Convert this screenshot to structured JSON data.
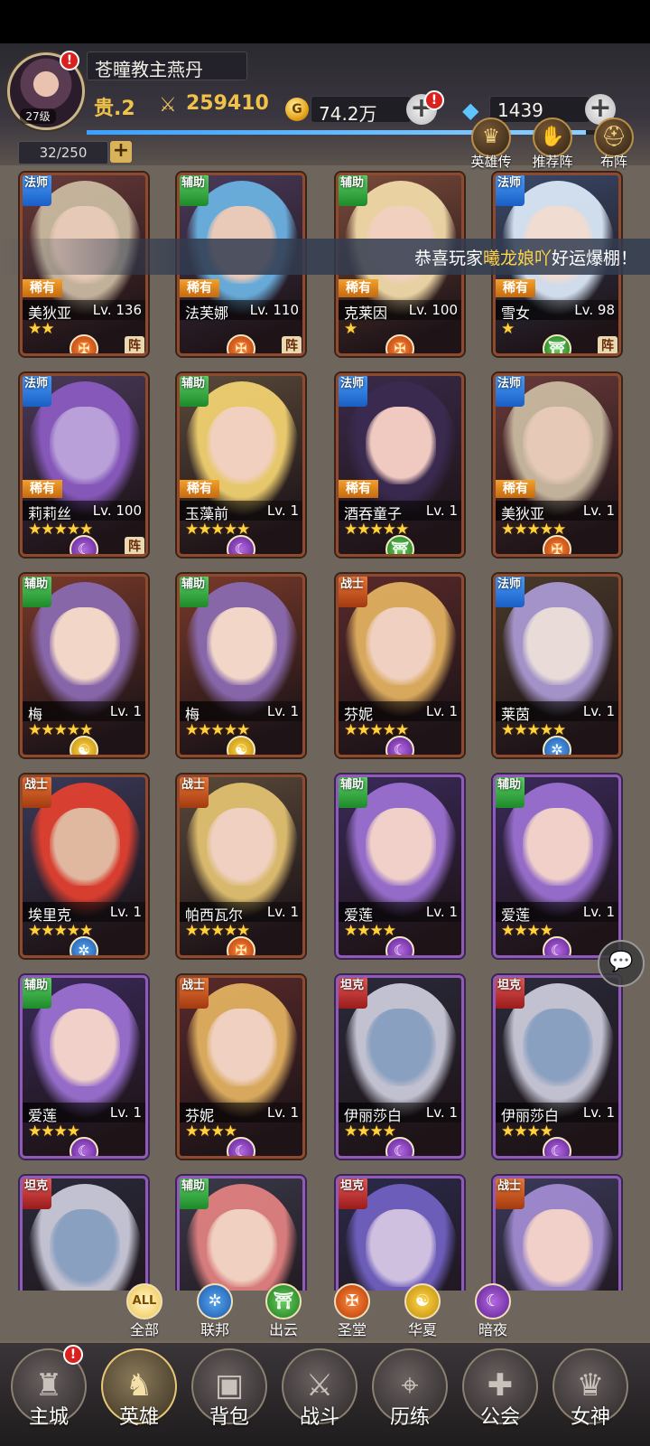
{
  "player": {
    "name": "苍瞳教主燕丹",
    "level": "27级",
    "vip": "贵.2",
    "power": "259410",
    "xp_fraction": 0.97
  },
  "resources": {
    "gold": "74.2万",
    "gems": "1439"
  },
  "roster_count": "32/250",
  "top_buttons": [
    {
      "label": "英雄传",
      "icon": "crown-icon"
    },
    {
      "label": "推荐阵",
      "icon": "thumbs-up-icon"
    },
    {
      "label": "布阵",
      "icon": "helmet-icon"
    }
  ],
  "announcement": {
    "prefix": "恭喜玩家",
    "player": "曦龙娘吖",
    "suffix": "好运爆棚！"
  },
  "heroes": [
    {
      "class": "法师",
      "cls": "mage",
      "rarity": "稀有",
      "name": "美狄亚",
      "level": "Lv. 136",
      "stars": "★★",
      "faction": "holy",
      "team": "阵",
      "frame": "bronze",
      "palette": [
        "#6a3a3a",
        "#c9b9a0",
        "#e7c9b8"
      ]
    },
    {
      "class": "辅助",
      "cls": "support",
      "rarity": "稀有",
      "name": "法芙娜",
      "level": "Lv. 110",
      "stars": "",
      "faction": "holy",
      "team": "阵",
      "frame": "bronze",
      "palette": [
        "#4a3a5a",
        "#6ab0e0",
        "#e9c9b8"
      ]
    },
    {
      "class": "辅助",
      "cls": "support",
      "rarity": "稀有",
      "name": "克莱因",
      "level": "Lv. 100",
      "stars": "★",
      "faction": "holy",
      "team": "",
      "frame": "bronze",
      "palette": [
        "#7a4a3a",
        "#f0d9a8",
        "#f2d0c0"
      ]
    },
    {
      "class": "法师",
      "cls": "mage",
      "rarity": "稀有",
      "name": "雪女",
      "level": "Lv. 98",
      "stars": "★",
      "faction": "cloud",
      "team": "阵",
      "frame": "bronze",
      "palette": [
        "#3a4a6a",
        "#d9e6f5",
        "#f0dcd0"
      ]
    },
    {
      "class": "法师",
      "cls": "mage",
      "rarity": "稀有",
      "name": "莉莉丝",
      "level": "Lv. 100",
      "stars": "★★★★★",
      "faction": "dark",
      "team": "阵",
      "frame": "bronze",
      "palette": [
        "#4a3a5a",
        "#8a5ac0",
        "#b9a0d9"
      ]
    },
    {
      "class": "辅助",
      "cls": "support",
      "rarity": "稀有",
      "name": "玉藻前",
      "level": "Lv. 1",
      "stars": "★★★★★",
      "faction": "dark",
      "team": "",
      "frame": "bronze",
      "palette": [
        "#5a4a3a",
        "#f0d070",
        "#f2d0c0"
      ]
    },
    {
      "class": "法师",
      "cls": "mage",
      "rarity": "稀有",
      "name": "酒吞童子",
      "level": "Lv. 1",
      "stars": "★★★★★",
      "faction": "cloud",
      "team": "",
      "frame": "bronze",
      "palette": [
        "#3a2a4a",
        "#3a2a50",
        "#f0c9c0"
      ]
    },
    {
      "class": "法师",
      "cls": "mage",
      "rarity": "稀有",
      "name": "美狄亚",
      "level": "Lv. 1",
      "stars": "★★★★★",
      "faction": "holy",
      "team": "",
      "frame": "bronze",
      "palette": [
        "#6a3a3a",
        "#c9b9a0",
        "#e7c9b8"
      ]
    },
    {
      "class": "辅助",
      "cls": "support",
      "rarity": "",
      "name": "梅",
      "level": "Lv. 1",
      "stars": "★★★★★",
      "faction": "hua",
      "team": "",
      "frame": "bronze",
      "palette": [
        "#7a3a2a",
        "#8a6ab0",
        "#f2d6c8"
      ]
    },
    {
      "class": "辅助",
      "cls": "support",
      "rarity": "",
      "name": "梅",
      "level": "Lv. 1",
      "stars": "★★★★★",
      "faction": "hua",
      "team": "",
      "frame": "bronze",
      "palette": [
        "#7a3a2a",
        "#8a6ab0",
        "#f2d6c8"
      ]
    },
    {
      "class": "战士",
      "cls": "warrior",
      "rarity": "",
      "name": "芬妮",
      "level": "Lv. 1",
      "stars": "★★★★★",
      "faction": "dark",
      "team": "",
      "frame": "bronze",
      "palette": [
        "#5a2a2a",
        "#e0b060",
        "#f0d0c0"
      ]
    },
    {
      "class": "法师",
      "cls": "mage",
      "rarity": "",
      "name": "莱茵",
      "level": "Lv. 1",
      "stars": "★★★★★",
      "faction": "union",
      "team": "",
      "frame": "bronze",
      "palette": [
        "#4a3a2a",
        "#a898d0",
        "#e9dcd8"
      ]
    },
    {
      "class": "战士",
      "cls": "warrior",
      "rarity": "",
      "name": "埃里克",
      "level": "Lv. 1",
      "stars": "★★★★★",
      "faction": "union",
      "team": "",
      "frame": "bronze",
      "palette": [
        "#3a3a5a",
        "#e04030",
        "#e0b8a0"
      ]
    },
    {
      "class": "战士",
      "cls": "warrior",
      "rarity": "",
      "name": "帕西瓦尔",
      "level": "Lv. 1",
      "stars": "★★★★★",
      "faction": "holy",
      "team": "",
      "frame": "bronze",
      "palette": [
        "#5a4a3a",
        "#e0c070",
        "#f0d0c0"
      ]
    },
    {
      "class": "辅助",
      "cls": "support",
      "rarity": "",
      "name": "爱莲",
      "level": "Lv. 1",
      "stars": "★★★★",
      "faction": "dark",
      "team": "",
      "frame": "purple",
      "palette": [
        "#3a2a5a",
        "#9a70d0",
        "#f0d0c8"
      ]
    },
    {
      "class": "辅助",
      "cls": "support",
      "rarity": "",
      "name": "爱莲",
      "level": "Lv. 1",
      "stars": "★★★★",
      "faction": "dark",
      "team": "",
      "frame": "purple",
      "palette": [
        "#3a2a5a",
        "#9a70d0",
        "#f0d0c8"
      ]
    },
    {
      "class": "辅助",
      "cls": "support",
      "rarity": "",
      "name": "爱莲",
      "level": "Lv. 1",
      "stars": "★★★★",
      "faction": "dark",
      "team": "",
      "frame": "purple",
      "palette": [
        "#3a2a5a",
        "#9a70d0",
        "#f0d0c8"
      ]
    },
    {
      "class": "战士",
      "cls": "warrior",
      "rarity": "",
      "name": "芬妮",
      "level": "Lv. 1",
      "stars": "★★★★",
      "faction": "dark",
      "team": "",
      "frame": "bronze",
      "palette": [
        "#5a2a2a",
        "#e0b060",
        "#f0d0c0"
      ]
    },
    {
      "class": "坦克",
      "cls": "tank",
      "rarity": "",
      "name": "伊丽莎白",
      "level": "Lv. 1",
      "stars": "★★★★",
      "faction": "dark",
      "team": "",
      "frame": "purple",
      "palette": [
        "#2a2a3a",
        "#c9c9d9",
        "#8aa0c0"
      ]
    },
    {
      "class": "坦克",
      "cls": "tank",
      "rarity": "",
      "name": "伊丽莎白",
      "level": "Lv. 1",
      "stars": "★★★★",
      "faction": "dark",
      "team": "",
      "frame": "purple",
      "palette": [
        "#2a2a3a",
        "#c9c9d9",
        "#8aa0c0"
      ]
    },
    {
      "class": "坦克",
      "cls": "tank",
      "rarity": "",
      "name": "",
      "level": "",
      "stars": "",
      "faction": "",
      "team": "",
      "frame": "purple",
      "palette": [
        "#2a2a3a",
        "#c9c9d9",
        "#8aa0c0"
      ]
    },
    {
      "class": "辅助",
      "cls": "support",
      "rarity": "",
      "name": "",
      "level": "",
      "stars": "",
      "faction": "",
      "team": "",
      "frame": "purple",
      "palette": [
        "#3a3a4a",
        "#e08080",
        "#f0d0c0"
      ]
    },
    {
      "class": "坦克",
      "cls": "tank",
      "rarity": "",
      "name": "",
      "level": "",
      "stars": "",
      "faction": "",
      "team": "",
      "frame": "purple",
      "palette": [
        "#2a2a4a",
        "#7060c0",
        "#d0c0e0"
      ]
    },
    {
      "class": "战士",
      "cls": "warrior",
      "rarity": "",
      "name": "",
      "level": "",
      "stars": "",
      "faction": "",
      "team": "",
      "frame": "purple",
      "palette": [
        "#3a3a5a",
        "#a08ad0",
        "#f0d0c8"
      ]
    }
  ],
  "filters": [
    {
      "label": "全部",
      "icon": "ALL",
      "key": "all"
    },
    {
      "label": "联邦",
      "icon": "✲",
      "key": "union"
    },
    {
      "label": "出云",
      "icon": "⛩",
      "key": "cloud"
    },
    {
      "label": "圣堂",
      "icon": "✠",
      "key": "holy"
    },
    {
      "label": "华夏",
      "icon": "☯",
      "key": "hua"
    },
    {
      "label": "暗夜",
      "icon": "☾",
      "key": "dark"
    }
  ],
  "nav": [
    {
      "label": "主城",
      "icon": "castle-icon",
      "glyph": "♜",
      "active": false,
      "alert": true
    },
    {
      "label": "英雄",
      "icon": "hooded-hero-icon",
      "glyph": "♞",
      "active": true,
      "alert": false
    },
    {
      "label": "背包",
      "icon": "backpack-icon",
      "glyph": "▣",
      "active": false,
      "alert": false
    },
    {
      "label": "战斗",
      "icon": "crossed-swords-icon",
      "glyph": "⚔",
      "active": false,
      "alert": false
    },
    {
      "label": "历练",
      "icon": "map-icon",
      "glyph": "⌖",
      "active": false,
      "alert": false
    },
    {
      "label": "公会",
      "icon": "shield-cross-icon",
      "glyph": "✚",
      "active": false,
      "alert": false
    },
    {
      "label": "女神",
      "icon": "goddess-icon",
      "glyph": "♛",
      "active": false,
      "alert": false
    }
  ],
  "alert_mark": "!"
}
